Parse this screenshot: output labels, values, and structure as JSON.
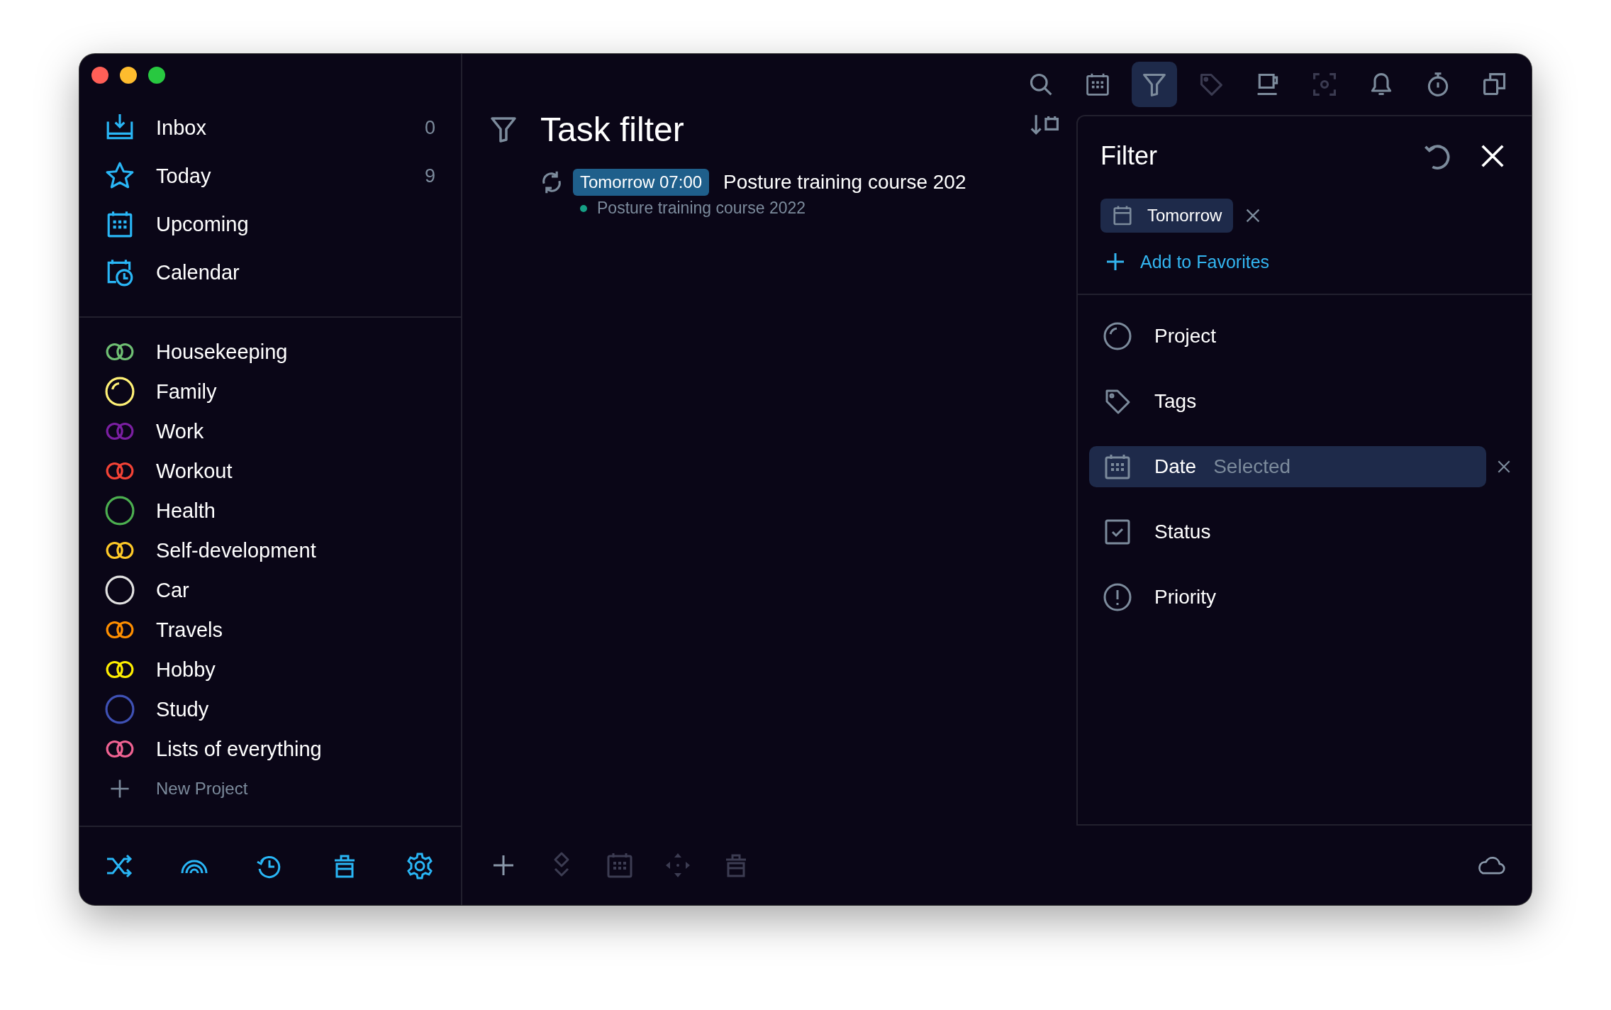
{
  "window": {
    "controls": [
      {
        "color": "#ff5f57"
      },
      {
        "color": "#febc2e"
      },
      {
        "color": "#28c840"
      }
    ]
  },
  "sidebar": {
    "views": [
      {
        "kind": "inbox",
        "label": "Inbox",
        "count": "0"
      },
      {
        "kind": "today",
        "label": "Today",
        "count": "9"
      },
      {
        "kind": "upcoming",
        "label": "Upcoming"
      },
      {
        "kind": "calendar",
        "label": "Calendar"
      }
    ],
    "projects": [
      {
        "kind": "double",
        "label": "Housekeeping",
        "color": "#6fbf73"
      },
      {
        "kind": "partial",
        "label": "Family",
        "color": "#fff176"
      },
      {
        "kind": "double",
        "label": "Work",
        "color": "#7b1fa2"
      },
      {
        "kind": "double",
        "label": "Workout",
        "color": "#f44336"
      },
      {
        "kind": "ring",
        "label": "Health",
        "color": "#4caf50"
      },
      {
        "kind": "double",
        "label": "Self-development",
        "color": "#ffca28"
      },
      {
        "kind": "ring",
        "label": "Car",
        "color": "#e0e0e0"
      },
      {
        "kind": "double",
        "label": "Travels",
        "color": "#ff8f00"
      },
      {
        "kind": "double",
        "label": "Hobby",
        "color": "#ffee00"
      },
      {
        "kind": "ring",
        "label": "Study",
        "color": "#3f51b5"
      },
      {
        "kind": "double",
        "label": "Lists of everything",
        "color": "#f06292"
      }
    ],
    "new_project": "New Project",
    "toolbar": [
      {
        "kind": "shuffle"
      },
      {
        "kind": "rainbow"
      },
      {
        "kind": "history"
      },
      {
        "kind": "trash"
      },
      {
        "kind": "settings"
      }
    ]
  },
  "toolbar": [
    {
      "kind": "search",
      "selected": false,
      "disabled": false
    },
    {
      "kind": "calendar",
      "selected": false,
      "disabled": false
    },
    {
      "kind": "filter",
      "selected": true,
      "disabled": false
    },
    {
      "kind": "tag",
      "selected": false,
      "disabled": true
    },
    {
      "kind": "cup",
      "selected": false,
      "disabled": false
    },
    {
      "kind": "focus",
      "selected": false,
      "disabled": true
    },
    {
      "kind": "bell",
      "selected": false,
      "disabled": false
    },
    {
      "kind": "timer",
      "selected": false,
      "disabled": false
    },
    {
      "kind": "copy",
      "selected": false,
      "disabled": false
    }
  ],
  "main": {
    "title": "Task filter",
    "tasks": [
      {
        "when": "Tomorrow 07:00",
        "title": "Posture training course 202",
        "project": "Posture training course 2022",
        "color": "#16a085",
        "repeating": true
      }
    ],
    "toolbar": [
      {
        "kind": "add",
        "disabled": false
      },
      {
        "kind": "diamond",
        "disabled": true
      },
      {
        "kind": "calendar",
        "disabled": true
      },
      {
        "kind": "move",
        "disabled": true
      },
      {
        "kind": "trash",
        "disabled": true
      }
    ]
  },
  "filter": {
    "title": "Filter",
    "chips": [
      {
        "label": "Tomorrow"
      }
    ],
    "add_favorites": "Add to Favorites",
    "criteria": [
      {
        "kind": "project",
        "label": "Project",
        "selected": false
      },
      {
        "kind": "tags",
        "label": "Tags",
        "selected": false
      },
      {
        "kind": "date",
        "label": "Date",
        "value": "Selected",
        "selected": true
      },
      {
        "kind": "status",
        "label": "Status",
        "selected": false
      },
      {
        "kind": "priority",
        "label": "Priority",
        "selected": false
      }
    ]
  }
}
